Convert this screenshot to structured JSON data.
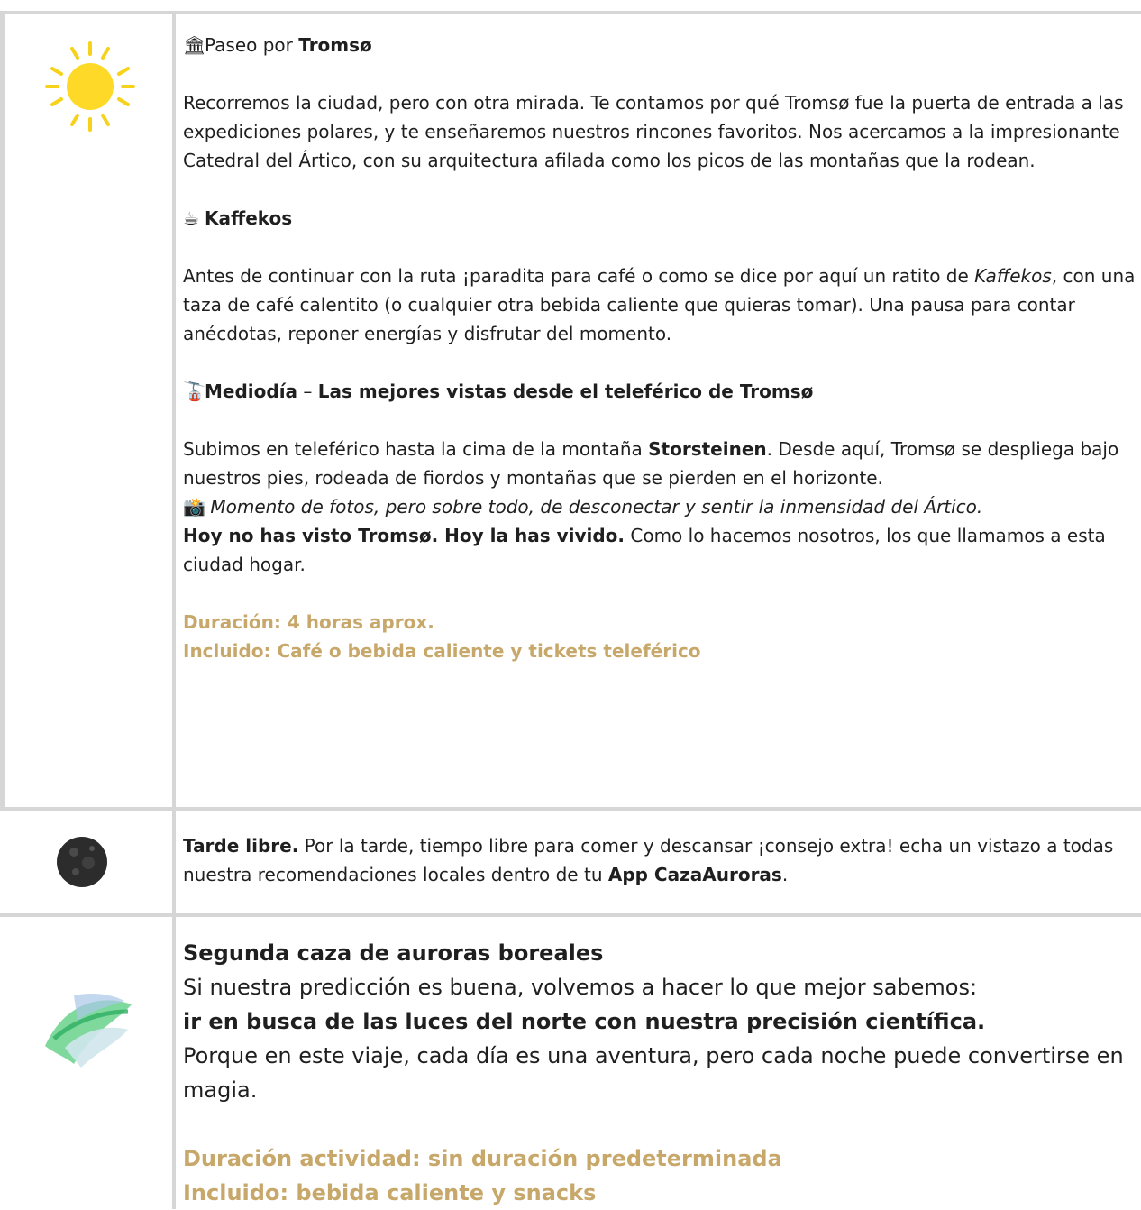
{
  "icons": {
    "row1": "sun-icon",
    "row2": "moon-icon",
    "row3": "aurora-icon",
    "inline": [
      "museum-icon",
      "coffee-icon",
      "aerial-tramway-icon",
      "camera-flash-icon"
    ]
  },
  "colors": {
    "accent": "#c7a86a",
    "border": "#d6d6d6",
    "text": "#1f1f1f"
  },
  "row1": {
    "paseo": {
      "emoji": "🏛",
      "pre": "Paseo por ",
      "bold": "Tromsø"
    },
    "paseo_text": "Recorremos la ciudad, pero con otra mirada. Te contamos por qué Tromsø fue la puerta de entrada a las expediciones polares, y te enseñaremos nuestros rincones favoritos. Nos acercamos a la impresionante Catedral del Ártico, con su arquitectura afilada como los picos de las montañas que la rodean.",
    "kaffekos": {
      "emoji": "☕",
      "title": "Kaffekos"
    },
    "kaffekos_text": {
      "pre": "Antes de continuar con la ruta ¡paradita para café o como se dice por aquí un ratito de ",
      "italic": "Kaffekos",
      "post": ", con una taza de café calentito (o cualquier otra bebida caliente que quieras tomar). Una pausa para contar anécdotas, reponer energías y disfrutar del momento."
    },
    "mediodia": {
      "emoji": "🚡",
      "bold1": "Mediodía",
      "dash": " – ",
      "bold2": "Las mejores vistas desde el teleférico de Tromsø"
    },
    "subimos": {
      "pre": "Subimos en teleférico hasta la cima de la montaña ",
      "bold": "Storsteinen",
      "post": ". Desde aquí, Tromsø se despliega bajo nuestros pies, rodeada de fiordos y montañas que se pierden en el horizonte."
    },
    "fotos": {
      "emoji": "📸",
      "italic": " Momento de fotos, pero sobre todo, de desconectar y sentir la inmensidad del Ártico."
    },
    "hoy": {
      "bold": "Hoy no has visto Tromsø. Hoy la has vivido.",
      "post": " Como lo hacemos nosotros, los que llamamos a esta ciudad hogar."
    },
    "duracion": "Duración: 4 horas aprox.",
    "incluido": "Incluido: Café o bebida caliente y tickets teleférico"
  },
  "row2": {
    "bold": "Tarde libre.",
    "pre": " Por la tarde, tiempo libre para comer y descansar ¡consejo extra! echa un vistazo a todas nuestra recomendaciones locales dentro de tu ",
    "bold2": "App CazaAuroras",
    "post": "."
  },
  "row3": {
    "title": "Segunda caza de auroras boreales",
    "line1": "Si nuestra predicción es buena, volvemos a hacer lo que mejor sabemos:",
    "line2": "ir en busca de las luces del norte con nuestra precisión científica.",
    "line3": "Porque en este viaje, cada día es una aventura, pero cada noche puede convertirse en magia.",
    "duracion": "Duración actividad: sin duración predeterminada",
    "incluido": "Incluido: bebida caliente y snacks"
  }
}
